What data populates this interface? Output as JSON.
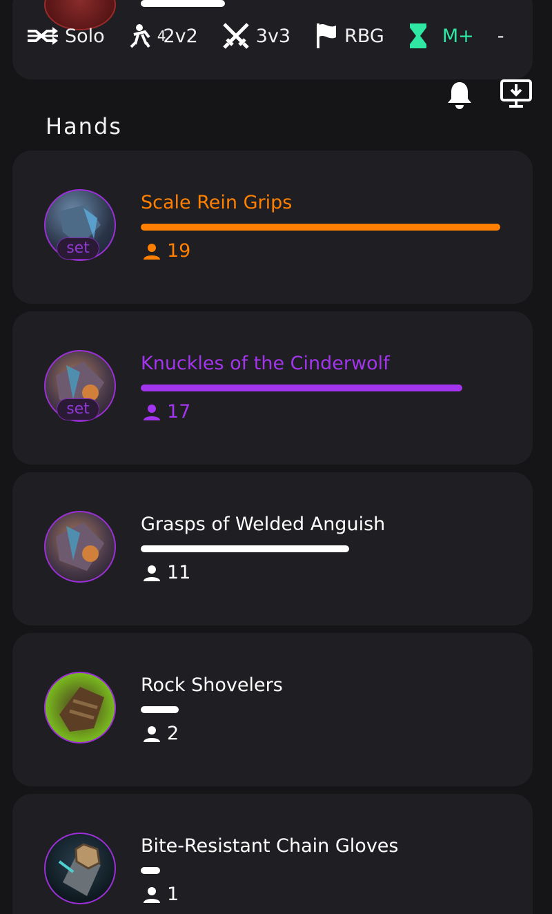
{
  "tabs": [
    {
      "label": "Solo",
      "icon": "shuffle-icon"
    },
    {
      "label": "2v2",
      "icon": "fight-icon",
      "superscript": "4"
    },
    {
      "label": "3v3",
      "icon": "crossed-swords-icon"
    },
    {
      "label": "RBG",
      "icon": "flag-icon"
    },
    {
      "label": "M+",
      "icon": "hourglass-icon"
    },
    {
      "label": "-",
      "icon": ""
    }
  ],
  "header_icons": {
    "notifications": "bell-icon",
    "download": "download-icon"
  },
  "section_title": "Hands",
  "colors": {
    "legendary": "#ff8000",
    "epic": "#a335ee",
    "common": "#ffffff",
    "mplus": "#2ee8a4",
    "card": "#1f1f23"
  },
  "items": [
    {
      "name": "Scale Rein Grips",
      "count": "19",
      "badge": "set",
      "color": "#ff8000",
      "fraction": 1.0
    },
    {
      "name": "Knuckles of the Cinderwolf",
      "count": "17",
      "badge": "set",
      "color": "#a335ee",
      "fraction": 0.895
    },
    {
      "name": "Grasps of Welded Anguish",
      "count": "11",
      "badge": "",
      "color": "#ffffff",
      "fraction": 0.579
    },
    {
      "name": "Rock Shovelers",
      "count": "2",
      "badge": "",
      "color": "#ffffff",
      "fraction": 0.105
    },
    {
      "name": "Bite-Resistant Chain Gloves",
      "count": "1",
      "badge": "",
      "color": "#ffffff",
      "fraction": 0.053
    }
  ]
}
